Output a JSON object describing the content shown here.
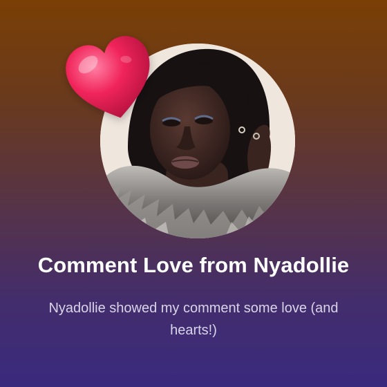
{
  "card": {
    "title": "Comment Love from Nyadollie",
    "subtitle": "Nyadollie showed my comment some love (and hearts!)"
  },
  "icons": {
    "heart": "heart-icon",
    "avatar": "profile-photo"
  },
  "colors": {
    "gradient_top": "#7a3f05",
    "gradient_bottom": "#3a2a7e",
    "heart": "#f0245a",
    "title_text": "#ffffff",
    "subtitle_text": "#d9d4e8"
  }
}
